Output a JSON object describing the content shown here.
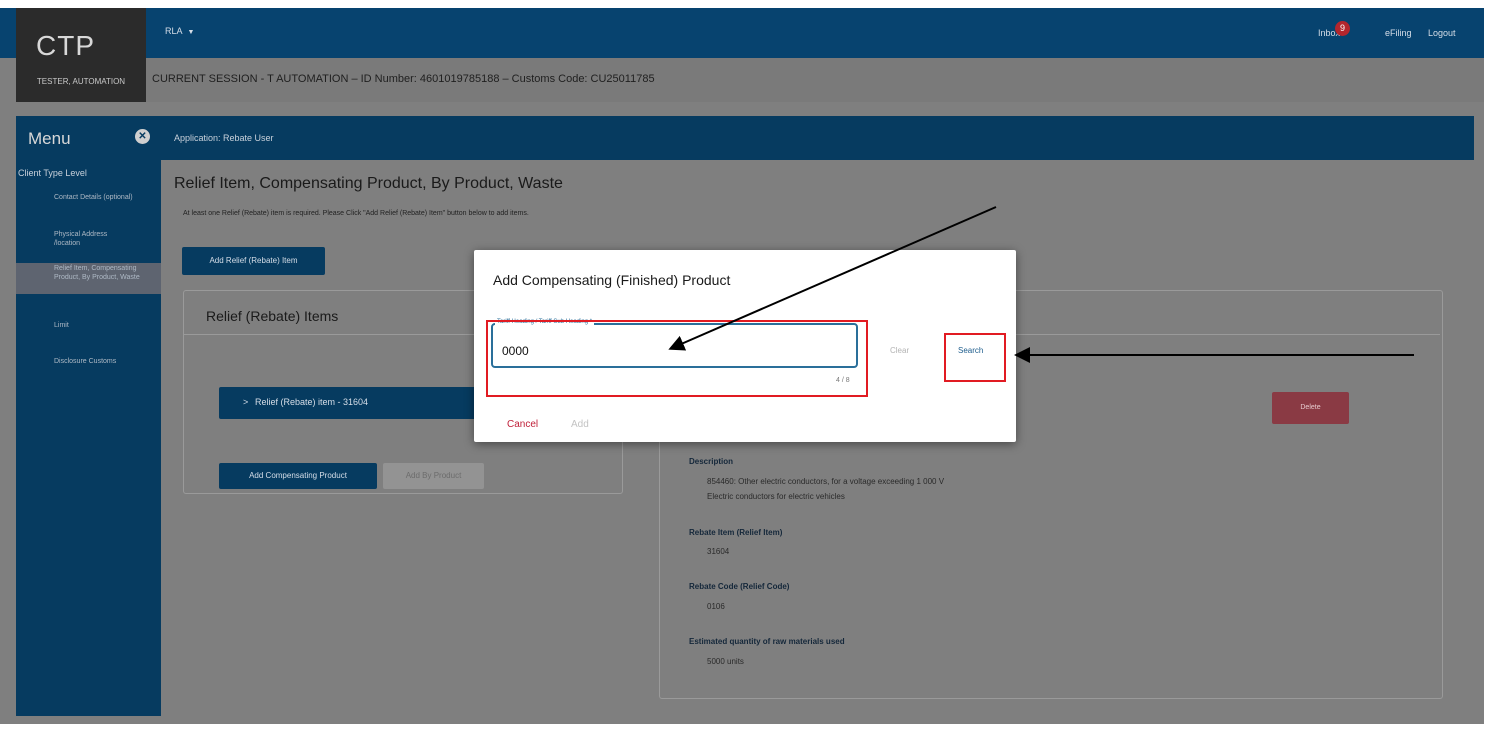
{
  "header": {
    "logo": "CTP",
    "user": "TESTER, AUTOMATION",
    "role": "RLA",
    "inbox": "Inbox",
    "inbox_count": "9",
    "efiling": "eFiling",
    "logout": "Logout",
    "session": "CURRENT SESSION - T AUTOMATION – ID Number: 4601019785188 – Customs Code: CU25011785"
  },
  "menu": {
    "title": "Menu",
    "level": "Client Type Level",
    "items": [
      "Contact Details (optional)",
      "Physical Address /location",
      "Relief Item, Compensating Product, By Product, Waste",
      "Limit",
      "Disclosure Customs"
    ]
  },
  "app": {
    "header": "Application: Rebate User"
  },
  "main": {
    "title": "Relief Item, Compensating Product, By Product, Waste",
    "instruction": "At least one Relief (Rebate) item is required. Please Click \"Add Relief (Rebate) Item\" button below to add items.",
    "add_relief_button": "Add Relief (Rebate) Item",
    "relief_card_title": "Relief (Rebate) Items",
    "relief_item": "Relief (Rebate) item - 31604",
    "add_compensating_button": "Add Compensating Product",
    "add_by_product_button": "Add By Product",
    "delete_button": "Delete"
  },
  "details": [
    {
      "label": "Description",
      "value": "854460: Other electric conductors, for a voltage exceeding 1 000 V",
      "value2": "Electric conductors for electric vehicles"
    },
    {
      "label": "Rebate Item (Relief Item)",
      "value": "31604"
    },
    {
      "label": "Rebate Code (Relief Code)",
      "value": "0106"
    },
    {
      "label": "Estimated quantity of raw materials used",
      "value": "5000 units"
    }
  ],
  "modal": {
    "title": "Add Compensating (Finished) Product",
    "field_label": "Tariff Heading / Tariff Sub Heading *",
    "field_value": "0000",
    "counter": "4 / 8",
    "clear": "Clear",
    "search": "Search",
    "cancel": "Cancel",
    "add": "Add"
  },
  "colors": {
    "brand": "#063b60",
    "highlight": "#e11b22",
    "danger": "#c0213a"
  }
}
